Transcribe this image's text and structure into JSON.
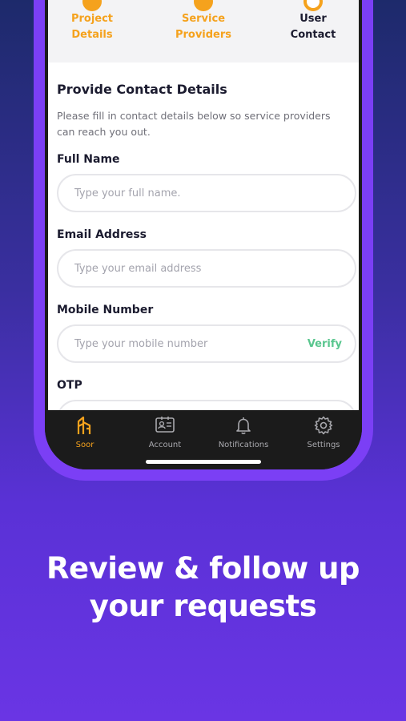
{
  "stepper": {
    "steps": [
      {
        "line1": "Project",
        "line2": "Details",
        "state": "done"
      },
      {
        "line1": "Service",
        "line2": "Providers",
        "state": "done"
      },
      {
        "line1": "User",
        "line2": "Contact",
        "state": "current"
      }
    ]
  },
  "form": {
    "title": "Provide Contact Details",
    "subtitle": "Please fill in contact details below so service providers can reach you out.",
    "full_name": {
      "label": "Full Name",
      "placeholder": "Type your full name."
    },
    "email": {
      "label": "Email Address",
      "placeholder": "Type your email address"
    },
    "mobile": {
      "label": "Mobile Number",
      "placeholder": "Type your mobile number",
      "verify_label": "Verify"
    },
    "otp": {
      "label": "OTP"
    }
  },
  "tabbar": {
    "tabs": [
      {
        "label": "Soor",
        "icon": "soor-logo-icon",
        "active": true
      },
      {
        "label": "Account",
        "icon": "id-card-icon",
        "active": false
      },
      {
        "label": "Notifications",
        "icon": "bell-icon",
        "active": false
      },
      {
        "label": "Settings",
        "icon": "gear-icon",
        "active": false
      }
    ]
  },
  "headline": {
    "line1": "Review & follow up",
    "line2": "your requests"
  },
  "colors": {
    "accent": "#f5a21d",
    "brand_purple": "#7b3ff5",
    "verify_green": "#59c68e"
  }
}
